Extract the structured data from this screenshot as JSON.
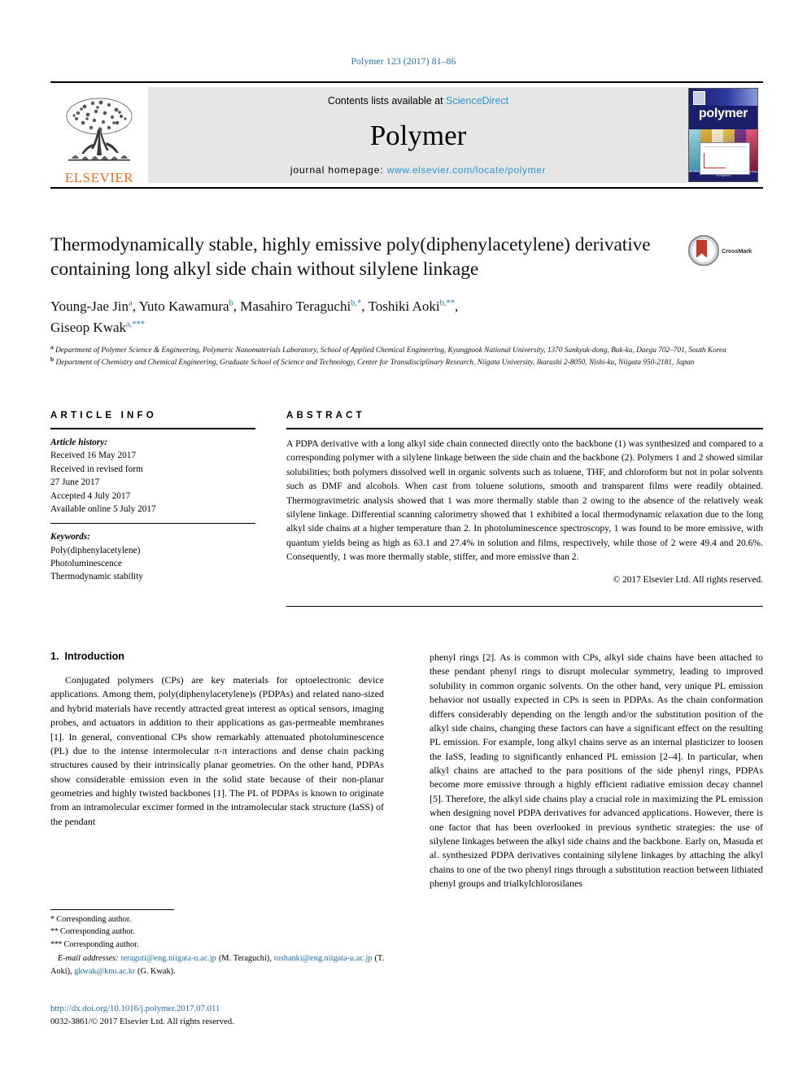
{
  "running_head": "Polymer 123 (2017) 81–86",
  "masthead": {
    "publisher": "ELSEVIER",
    "contents_prefix": "Contents lists available at ",
    "contents_link": "ScienceDirect",
    "journal_name": "Polymer",
    "homepage_prefix": "journal homepage: ",
    "homepage_url": "www.elsevier.com/locate/polymer",
    "cover_title": "polymer",
    "cover_footer": "An International Journal for the Science and Technology of Polymers"
  },
  "crossmark": {
    "label": "CrossMark"
  },
  "article": {
    "title": "Thermodynamically stable, highly emissive poly(diphenylacetylene) derivative containing long alkyl side chain without silylene linkage",
    "authors": [
      {
        "name": "Young-Jae Jin",
        "marks": "a"
      },
      {
        "name": "Yuto Kawamura",
        "marks": "b"
      },
      {
        "name": "Masahiro Teraguchi",
        "marks": "b,*"
      },
      {
        "name": "Toshiki Aoki",
        "marks": "b,**"
      },
      {
        "name": "Giseop Kwak",
        "marks": "a,***"
      }
    ],
    "authors_line1": "Young-Jae Jin",
    "affiliations": [
      {
        "mark": "a",
        "text": "Department of Polymer Science & Engineering, Polymeric Nanomaterials Laboratory, School of Applied Chemical Engineering, Kyungpook National University, 1370 Sankyuk-dong, Buk-ku, Daegu 702–701, South Korea"
      },
      {
        "mark": "b",
        "text": "Department of Chemistry and Chemical Engineering, Graduate School of Science and Technology, Center for Transdisciplinary Research, Niigata University, Ikarashi 2-8050, Nishi-ku, Niigata 950-2181, Japan"
      }
    ]
  },
  "article_info": {
    "heading": "ARTICLE INFO",
    "history_label": "Article history:",
    "history": [
      "Received 16 May 2017",
      "Received in revised form",
      "27 June 2017",
      "Accepted 4 July 2017",
      "Available online 5 July 2017"
    ],
    "keywords_label": "Keywords:",
    "keywords": [
      "Poly(diphenylacetylene)",
      "Photoluminescence",
      "Thermodynamic stability"
    ]
  },
  "abstract": {
    "heading": "ABSTRACT",
    "text": "A PDPA derivative with a long alkyl side chain connected directly onto the backbone (1) was synthesized and compared to a corresponding polymer with a silylene linkage between the side chain and the backbone (2). Polymers 1 and 2 showed similar solubilities; both polymers dissolved well in organic solvents such as toluene, THF, and chloroform but not in polar solvents such as DMF and alcohols. When cast from toluene solutions, smooth and transparent films were readily obtained. Thermogravimetric analysis showed that 1 was more thermally stable than 2 owing to the absence of the relatively weak silylene linkage. Differential scanning calorimetry showed that 1 exhibited a local thermodynamic relaxation due to the long alkyl side chains at a higher temperature than 2. In photoluminescence spectroscopy, 1 was found to be more emissive, with quantum yields being as high as 63.1 and 27.4% in solution and films, respectively, while those of 2 were 49.4 and 20.6%. Consequently, 1 was more thermally stable, stiffer, and more emissive than 2.",
    "copyright": "© 2017 Elsevier Ltd. All rights reserved."
  },
  "introduction": {
    "number": "1.",
    "title": "Introduction",
    "left_paragraph": "Conjugated polymers (CPs) are key materials for optoelectronic device applications. Among them, poly(diphenylacetylene)s (PDPAs) and related nano-sized and hybrid materials have recently attracted great interest as optical sensors, imaging probes, and actuators in addition to their applications as gas-permeable membranes [1]. In general, conventional CPs show remarkably attenuated photoluminescence (PL) due to the intense intermolecular π-π interactions and dense chain packing structures caused by their intrinsically planar geometries. On the other hand, PDPAs show considerable emission even in the solid state because of their non-planar geometries and highly twisted backbones [1]. The PL of PDPAs is known to originate from an intramolecular excimer formed in the intramolecular stack structure (IaSS) of the pendant",
    "right_paragraph": "phenyl rings [2]. As is common with CPs, alkyl side chains have been attached to these pendant phenyl rings to disrupt molecular symmetry, leading to improved solubility in common organic solvents. On the other hand, very unique PL emission behavior not usually expected in CPs is seen in PDPAs. As the chain conformation differs considerably depending on the length and/or the substitution position of the alkyl side chains, changing these factors can have a significant effect on the resulting PL emission. For example, long alkyl chains serve as an internal plasticizer to loosen the IaSS, leading to significantly enhanced PL emission [2–4]. In particular, when alkyl chains are attached to the para positions of the side phenyl rings, PDPAs become more emissive through a highly efficient radiative emission decay channel [5]. Therefore, the alkyl side chains play a crucial role in maximizing the PL emission when designing novel PDPA derivatives for advanced applications. However, there is one factor that has been overlooked in previous synthetic strategies: the use of silylene linkages between the alkyl side chains and the backbone. Early on, Masuda et al. synthesized PDPA derivatives containing silylene linkages by attaching the alkyl chains to one of the two phenyl rings through a substitution reaction between lithiated phenyl groups and trialkylchlorosilanes"
  },
  "footnotes": {
    "corresponding": [
      {
        "star": "*",
        "text": "Corresponding author."
      },
      {
        "star": "**",
        "text": "Corresponding author."
      },
      {
        "star": "***",
        "text": "Corresponding author."
      }
    ],
    "email_label": "E-mail addresses:",
    "emails": [
      {
        "address": "teraguti@eng.niigata-u.ac.jp",
        "person": "(M. Teraguchi)"
      },
      {
        "address": "toshanki@eng.niigata-u.ac.jp",
        "person": "(T. Aoki)"
      },
      {
        "address": "gkwak@knu.ac.kr",
        "person": "(G. Kwak)"
      }
    ],
    "doi": "http://dx.doi.org/10.1016/j.polymer.2017.07.011",
    "issn_line": "0032-3861/© 2017 Elsevier Ltd. All rights reserved."
  },
  "colors": {
    "link_blue": "#1f6fa8",
    "sciencedirect_blue": "#2a96d4",
    "elsevier_orange": "#E9711C",
    "cover_navy": "#1b1f6b"
  }
}
